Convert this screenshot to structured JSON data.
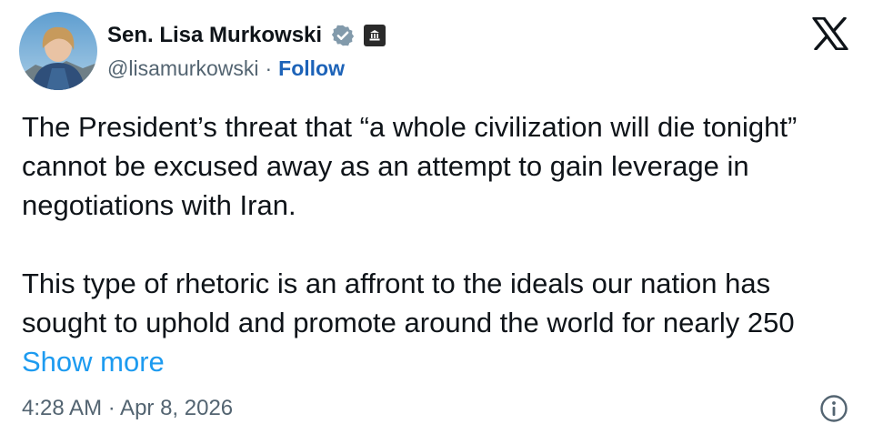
{
  "author": {
    "name": "Sen. Lisa Murkowski",
    "handle": "@lisamurkowski",
    "separator": "·",
    "follow_label": "Follow",
    "verified_icon": "verified-badge-icon",
    "affiliation_icon": "government-building-icon"
  },
  "platform": {
    "logo": "x-logo-icon"
  },
  "tweet": {
    "paragraph_1": "The President’s threat that “a whole civilization will die tonight” cannot be excused away as an attempt to gain leverage in negotiations with Iran.",
    "paragraph_2": "This type of rhetoric is an affront to the ideals our nation has sought to uphold and promote around the world for nearly 250",
    "show_more_label": "Show more"
  },
  "meta": {
    "timestamp": "4:28 AM · Apr 8, 2026",
    "info_icon": "info-icon"
  },
  "colors": {
    "text": "#0f1419",
    "secondary": "#536471",
    "link": "#1d9bf0",
    "follow": "#1d63b8",
    "verified": "#829aab"
  }
}
